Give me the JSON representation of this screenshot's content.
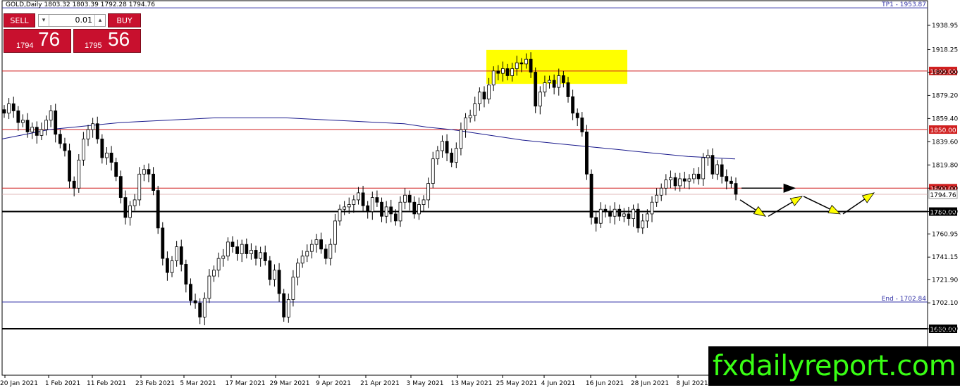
{
  "header": {
    "title": "GOLD,Daily  1803.32 1803.39 1792.28 1794.76"
  },
  "trade_panel": {
    "sell_label": "SELL",
    "buy_label": "BUY",
    "lot_value": "0.01",
    "sell_price_small": "1794",
    "sell_price_big": "76",
    "buy_price_small": "1795",
    "buy_price_big": "56"
  },
  "watermark": "fxdailyreport.com",
  "colors": {
    "red_line": "#d01f1f",
    "black_line": "#000000",
    "blue_line": "#3434a8",
    "ma_line": "#1a1a8c",
    "highlight": "#ffff00",
    "arrow_fill": "#ffff00",
    "bullish_candle": "#ffffff",
    "bearish_candle": "#000000"
  },
  "chart_data": {
    "type": "candlestick",
    "instrument": "GOLD",
    "timeframe": "Daily",
    "y_ticks": [
      1938.95,
      1918.25,
      1899.0,
      1879.2,
      1859.4,
      1839.6,
      1819.8,
      1800.0,
      1780.0,
      1760.95,
      1741.15,
      1721.9,
      1702.1,
      1680.0
    ],
    "x_ticks": [
      "20 Jan 2021",
      "1 Feb 2021",
      "11 Feb 2021",
      "23 Feb 2021",
      "5 Mar 2021",
      "17 Mar 2021",
      "29 Mar 2021",
      "9 Apr 2021",
      "21 Apr 2021",
      "3 May 2021",
      "13 May 2021",
      "25 May 2021",
      "4 Jun 2021",
      "16 Jun 2021",
      "28 Jun 2021",
      "8 Jul 2021"
    ],
    "ylim": [
      1668,
      1956
    ],
    "levels": [
      {
        "label": "TP1 - 1953.87",
        "value": 1953.87,
        "style": "blue",
        "tag": false
      },
      {
        "label": "1900.00",
        "value": 1900.0,
        "style": "red",
        "tag": true
      },
      {
        "label": "1850.00",
        "value": 1850.0,
        "style": "red",
        "tag": true
      },
      {
        "label": "1800.00",
        "value": 1800.0,
        "style": "red",
        "tag": true
      },
      {
        "label": "1780.00",
        "value": 1780.0,
        "style": "black",
        "tag": true
      },
      {
        "label": "End - 1702.84",
        "value": 1702.84,
        "style": "blue",
        "tag": false
      },
      {
        "label": "1680.00",
        "value": 1680.0,
        "style": "black",
        "tag": true
      }
    ],
    "current_price": {
      "label": "1794.76",
      "value": 1794.76
    },
    "candles_close": [
      1864,
      1872,
      1866,
      1856,
      1858,
      1848,
      1852,
      1845,
      1850,
      1858,
      1866,
      1846,
      1838,
      1832,
      1806,
      1800,
      1824,
      1842,
      1850,
      1855,
      1842,
      1826,
      1830,
      1822,
      1810,
      1792,
      1775,
      1785,
      1790,
      1812,
      1816,
      1812,
      1798,
      1766,
      1740,
      1728,
      1738,
      1750,
      1735,
      1718,
      1704,
      1702,
      1690,
      1706,
      1725,
      1730,
      1740,
      1742,
      1754,
      1750,
      1744,
      1752,
      1744,
      1747,
      1740,
      1745,
      1738,
      1722,
      1730,
      1710,
      1690,
      1705,
      1724,
      1736,
      1742,
      1746,
      1752,
      1756,
      1748,
      1740,
      1752,
      1772,
      1782,
      1784,
      1786,
      1790,
      1796,
      1785,
      1780,
      1792,
      1788,
      1776,
      1784,
      1778,
      1772,
      1788,
      1794,
      1788,
      1778,
      1786,
      1790,
      1804,
      1825,
      1832,
      1840,
      1830,
      1822,
      1834,
      1850,
      1860,
      1862,
      1872,
      1882,
      1876,
      1888,
      1900,
      1898,
      1902,
      1896,
      1902,
      1907,
      1906,
      1910,
      1899,
      1870,
      1882,
      1890,
      1892,
      1886,
      1896,
      1890,
      1878,
      1864,
      1860,
      1848,
      1812,
      1775,
      1770,
      1782,
      1780,
      1776,
      1782,
      1776,
      1778,
      1774,
      1782,
      1766,
      1772,
      1778,
      1788,
      1794,
      1800,
      1807,
      1809,
      1802,
      1808,
      1806,
      1808,
      1812,
      1808,
      1826,
      1828,
      1812,
      1820,
      1810,
      1806,
      1804,
      1794.76
    ],
    "ma_description": "200-period moving average, blue line",
    "annotations": {
      "highlight_box": {
        "from_value": 1889,
        "to_value": 1918
      },
      "projection_arrows": "yellow zigzag arrows projecting price path"
    }
  }
}
